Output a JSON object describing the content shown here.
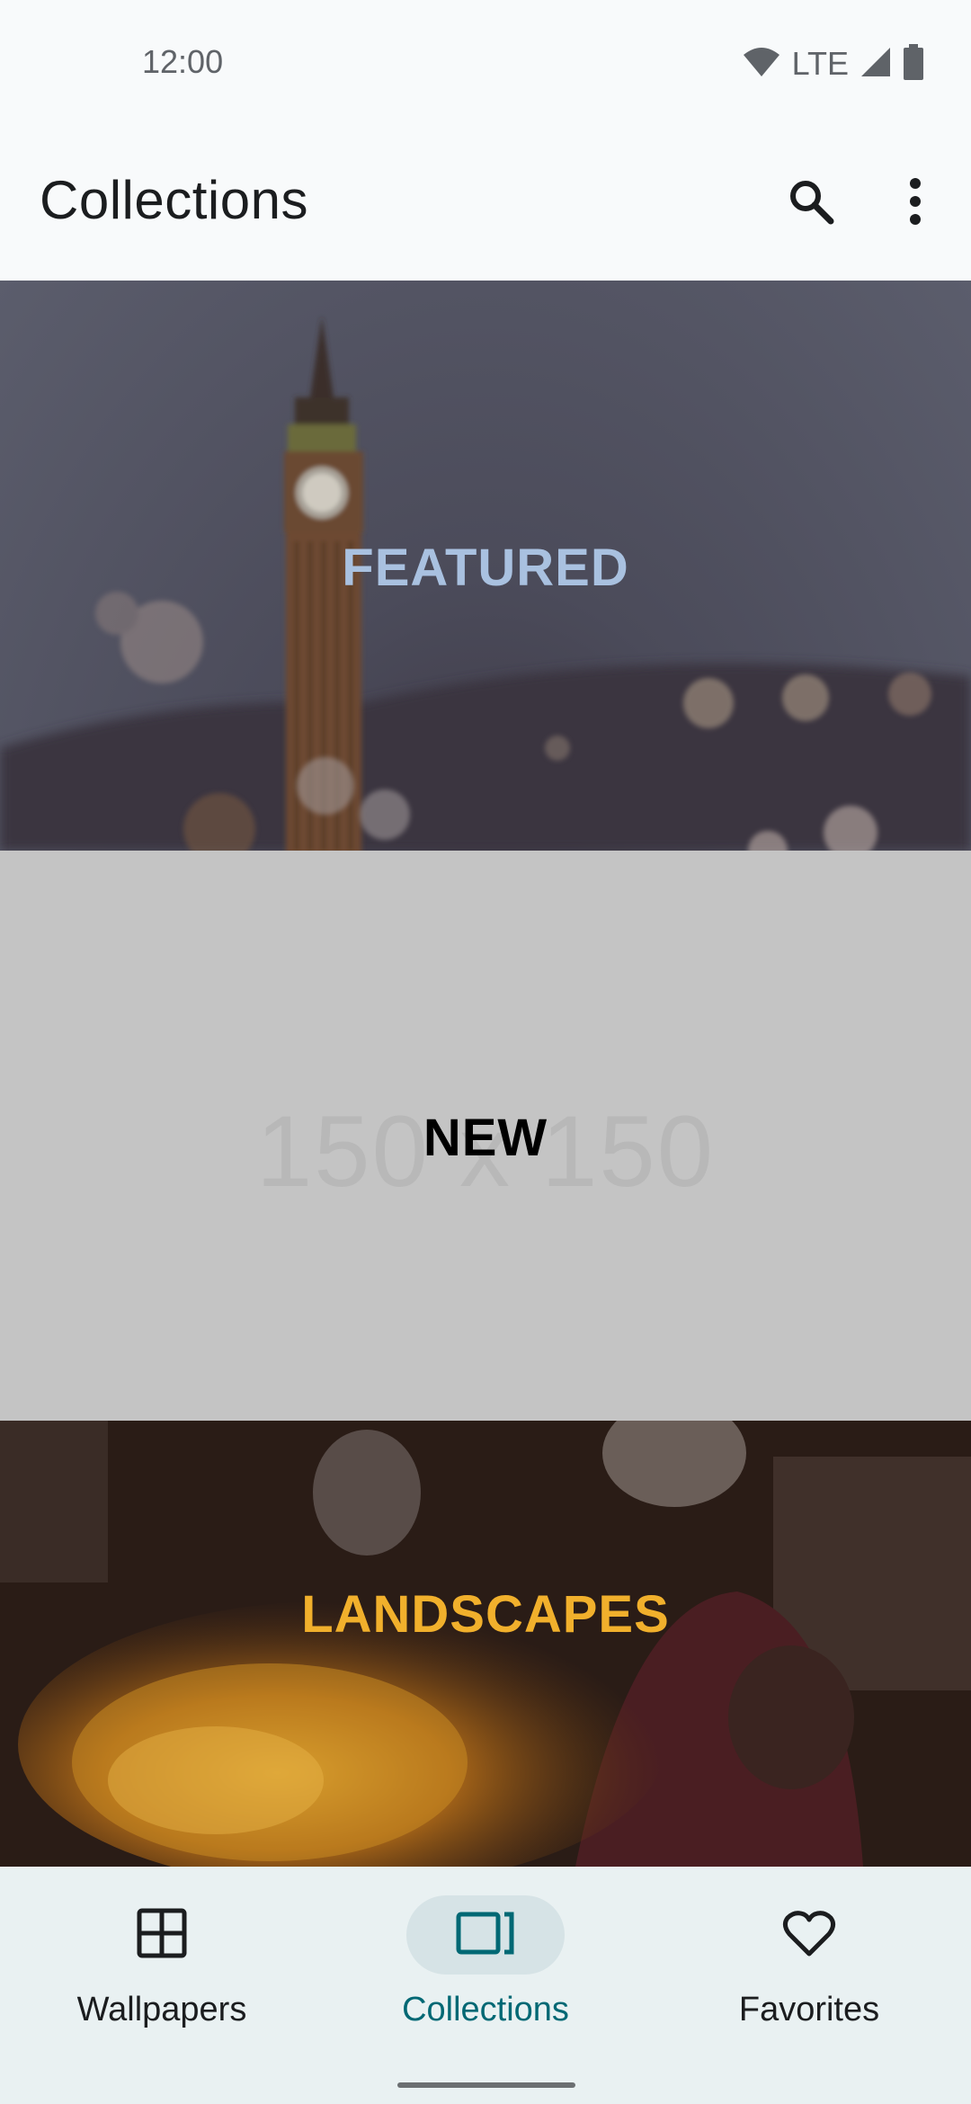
{
  "status_bar": {
    "time": "12:00",
    "network": "LTE"
  },
  "app_bar": {
    "title": "Collections",
    "icons": [
      "search-icon",
      "more-vert-icon"
    ]
  },
  "collections": [
    {
      "label": "FEATURED",
      "label_color": "#a9c1e0"
    },
    {
      "label": "NEW",
      "label_color": "#000000",
      "placeholder_text": "150 x 150"
    },
    {
      "label": "LANDSCAPES",
      "label_color": "#f1b02c"
    }
  ],
  "bottom_nav": {
    "items": [
      {
        "label": "Wallpapers",
        "icon": "grid-icon",
        "active": false
      },
      {
        "label": "Collections",
        "icon": "collections-icon",
        "active": true
      },
      {
        "label": "Favorites",
        "icon": "heart-icon",
        "active": false
      }
    ],
    "active_color": "#006874"
  }
}
